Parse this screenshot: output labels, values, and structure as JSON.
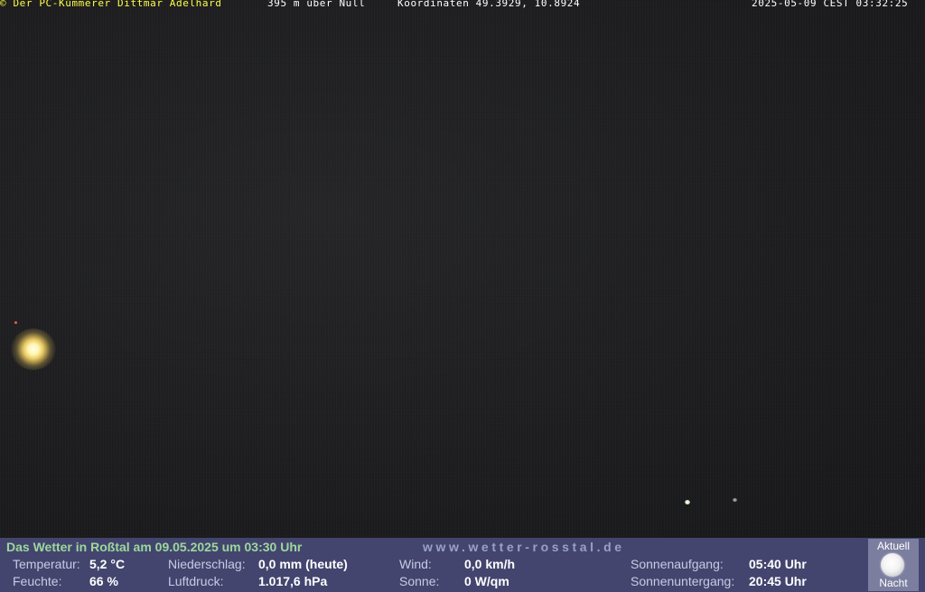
{
  "overlay": {
    "copyright": "© Der PC-Kümmerer Dittmar Adelhard",
    "altitude": "395 m über Null",
    "coordinates": "Koordinaten 49.3929, 10.8924",
    "datetime": "2025-05-09 CEST 03:32:25"
  },
  "panel": {
    "title": "Das Wetter in Roßtal am 09.05.2025 um 03:30 Uhr",
    "website": "www.wetter-rosstal.de",
    "temperature": {
      "label": "Temperatur:",
      "value": "5,2 °C"
    },
    "humidity": {
      "label": "Feuchte:",
      "value": "66 %"
    },
    "precipitation": {
      "label": "Niederschlag:",
      "value": "0,0 mm (heute)"
    },
    "pressure": {
      "label": "Luftdruck:",
      "value": "1.017,6 hPa"
    },
    "wind": {
      "label": "Wind:",
      "value": "0,0 km/h"
    },
    "sun": {
      "label": "Sonne:",
      "value": "0 W/qm"
    },
    "sunrise": {
      "label": "Sonnenaufgang:",
      "value": "05:40 Uhr"
    },
    "sunset": {
      "label": "Sonnenuntergang:",
      "value": "20:45 Uhr"
    },
    "moon": {
      "top_label": "Aktuell",
      "bottom_label": "Nacht",
      "icon": "moon-icon"
    }
  },
  "colors": {
    "panel_background": "#43456f",
    "title_green": "#9cd89a",
    "overlay_yellow": "#ffff44"
  }
}
